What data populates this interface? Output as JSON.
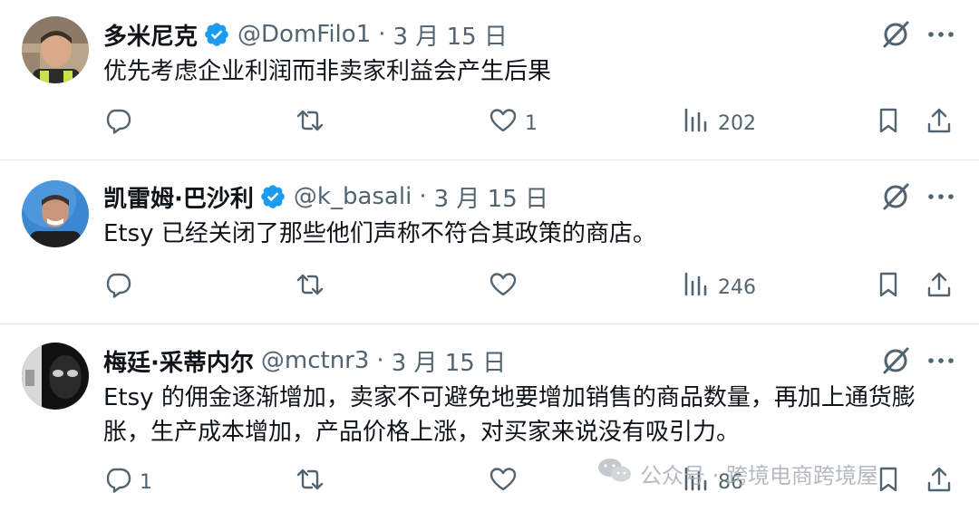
{
  "tweets": [
    {
      "author_name": "多米尼克",
      "verified": true,
      "handle": "@DomFilo1",
      "separator": "·",
      "date": "3 月 15 日",
      "text": "优先考虑企业利润而非卖家利益会产生后果",
      "replies": "",
      "reposts": "",
      "likes": "1",
      "views": "202"
    },
    {
      "author_name": "凯雷姆·巴沙利",
      "verified": true,
      "handle": "@k_basali",
      "separator": "·",
      "date": "3 月 15 日",
      "text": "Etsy 已经关闭了那些他们声称不符合其政策的商店。",
      "replies": "",
      "reposts": "",
      "likes": "",
      "views": "246"
    },
    {
      "author_name": "梅廷·采蒂内尔",
      "verified": false,
      "handle": "@mctnr3",
      "separator": "·",
      "date": "3 月 15 日",
      "text": "Etsy 的佣金逐渐增加，卖家不可避免地要增加销售的商品数量，再加上通货膨胀，生产成本增加，产品价格上涨，对买家来说没有吸引力。",
      "replies": "1",
      "reposts": "",
      "likes": "",
      "views": "86"
    }
  ],
  "watermark": {
    "text": "公众号 · 跨境电商跨境屋"
  },
  "icons": {
    "verified": "verified-badge-icon",
    "grok": "grok-icon",
    "more": "more-icon",
    "reply": "reply-icon",
    "repost": "repost-icon",
    "like": "like-icon",
    "views": "views-icon",
    "bookmark": "bookmark-icon",
    "share": "share-icon"
  },
  "colors": {
    "verified": "#1d9bf0",
    "secondary_text": "#536471",
    "primary_text": "#0f1419"
  }
}
